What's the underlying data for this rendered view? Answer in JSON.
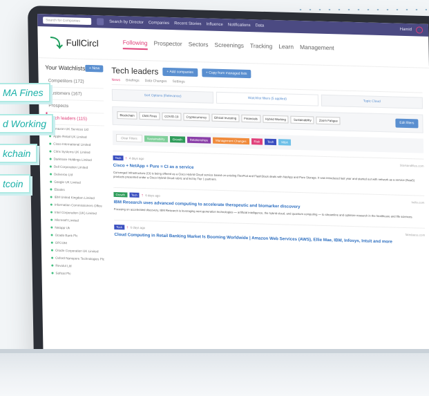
{
  "topbar": {
    "search_placeholder": "Search for Companies",
    "nav": [
      "Search by Director",
      "Companies",
      "Recent Stories",
      "Influence",
      "Notifications",
      "Data"
    ],
    "user": "Hamid"
  },
  "header": {
    "logo": "FullCircl",
    "nav": [
      "Following",
      "Prospector",
      "Sectors",
      "Screenings",
      "Tracking",
      "Learn",
      "Management"
    ],
    "active_nav": "Following"
  },
  "sidebar": {
    "title": "Your Watchlists",
    "new_label": "+ New",
    "items": [
      "Competitors (172)",
      "Customers (167)",
      "Prospects",
      "Tech leaders (115)"
    ],
    "companies": [
      "Amazon UK Services Ltd",
      "Apple Retail UK Limited",
      "Cisco International Limited",
      "Citrix Systems UK Limited",
      "Darktrace Holdings Limited",
      "Dell Corporation Limited",
      "Deliveroo Ltd",
      "Google UK Limited",
      "Ebooks",
      "IBM United Kingdom Limited",
      "Information Commissioners Office",
      "Intel Corporation (UK) Limited",
      "Microsoft Limited",
      "Netapp Uk",
      "Ocado Bank Plc",
      "OFCOM",
      "Oracle Corporation UK Limited",
      "Oxford Nanopore Technologies Plc",
      "Revolut Ltd",
      "Softcat Plc"
    ]
  },
  "main": {
    "title": "Tech leaders",
    "add_companies": "+ Add companies",
    "copy_label": "+ Copy from managed lists",
    "subtabs": [
      "News",
      "Briefings",
      "Data Changes",
      "Settings"
    ],
    "filter_tabs": [
      "Sort Options (Relevance)",
      "Watchlist filters (5 applied)",
      "Topic Cloud"
    ],
    "tags": [
      "Blockchain",
      "CMA Fines",
      "COVID-19",
      "Cryptocurrency",
      "Ethical Investing",
      "Financials",
      "Hybrid Working",
      "Sustainability",
      "Zoom Fatigue"
    ],
    "edit_filters": "Edit filters",
    "clear_filters": "Clear Filters",
    "color_filters": [
      {
        "label": "Sustainability",
        "color": "#7fcf9a"
      },
      {
        "label": "Growth",
        "color": "#2e9c5a"
      },
      {
        "label": "Relationships",
        "color": "#8a3fa8"
      },
      {
        "label": "Management Changes",
        "color": "#f08a3a"
      },
      {
        "label": "Risk",
        "color": "#e0407a"
      },
      {
        "label": "Tech",
        "color": "#3a4fc0"
      },
      {
        "label": "M&A",
        "color": "#6ec0e8"
      }
    ]
  },
  "articles": [
    {
      "tags": [
        {
          "label": "Tech",
          "color": "#3a4fc0"
        }
      ],
      "time": "4 days ago",
      "source": "Storkandfiles.com",
      "title": "Cisco + NetApp + Pure = CI as a service",
      "body": "Converged Infrastructure (CI) is being offered as a Cisco Hybrid Cloud service based on existing FlexPod and FlashStack deals with NetApp and Pure Storage. It was introduced last year and started out with network as a service (NaaS) products presented under a Cisco Hybrid Cloud rubric and led by Tier 1 partners."
    },
    {
      "tags": [
        {
          "label": "Growth",
          "color": "#2e9c5a"
        },
        {
          "label": "Tech",
          "color": "#3a4fc0"
        }
      ],
      "time": "6 days ago",
      "source": "hello.com",
      "title": "IBM Research uses advanced computing to accelerate therapeutic and biomarker discovery",
      "body": "Focusing on accelerated discovery, IBM Research is leveraging next-generation technologies — artificial intelligence, the hybrid cloud, and quantum computing — to streamline and optimize research in the healthcare and life sciences."
    },
    {
      "tags": [
        {
          "label": "Tech",
          "color": "#3a4fc0"
        }
      ],
      "time": "6 days ago",
      "source": "fatedaess.com",
      "title": "Cloud Computing in Retail Banking Market Is Booming Worldwide | Amazon Web Services (AWS), Ellie Mae, IBM, Infosys, Intuit and more",
      "body": ""
    }
  ],
  "floating_labels": [
    "MA Fines",
    "d Working",
    "kchain",
    "tcoin"
  ]
}
